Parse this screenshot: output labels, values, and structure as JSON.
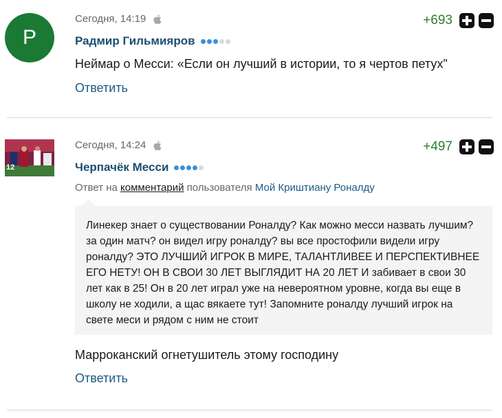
{
  "comments": [
    {
      "avatar_letter": "P",
      "avatar_color": "#1a7a33",
      "time": "Сегодня, 14:19",
      "platform_icon": "apple-icon",
      "rating": "+693",
      "author": "Радмир Гильмияров",
      "level_dots": 3,
      "level_max": 5,
      "text": "Неймар о Месси: «Если он лучший в истории, то я чертов петух\"",
      "reply_label": "Ответить"
    },
    {
      "avatar_image": "photo of football players",
      "time": "Сегодня, 14:24",
      "platform_icon": "apple-icon",
      "rating": "+497",
      "author": "Черпачёк Месси",
      "level_dots": 4,
      "level_max": 5,
      "reply_to": {
        "prefix": "Ответ на ",
        "comment_link": "комментарий",
        "middle": " пользователя ",
        "user_link": "Мой Криштиану Роналду"
      },
      "quote": "Линекер знает о существовании Роналду? Как можно месси назвать лучшим? за один матч? он видел игру роналду? вы все простофили видели игру роналду? ЭТО ЛУЧШИЙ ИГРОК В МИРЕ, ТАЛАНТЛИВЕЕ И ПЕРСПЕКТИВНЕЕ ЕГО НЕТУ! ОН В СВОИ 30 ЛЕТ ВЫГЛЯДИТ НА 20 ЛЕТ И забивает в свои 30 лет как в 25! Он в 20 лет играл уже на невероятном уровне, когда вы еще в школу не ходили, а щас вякаете тут! Запомните роналду лучший игрок на свете меси и рядом с ним не стоит",
      "text": "Марроканский огнетушитель этому господину",
      "reply_label": "Ответить"
    }
  ],
  "colors": {
    "rating_green": "#2e7d32",
    "author_blue": "#1a4f72",
    "link_blue": "#1a5a86",
    "dot_active": "#3d8fd6",
    "dot_inactive": "#d9d9d9",
    "quote_bg": "#f3f4f3"
  }
}
